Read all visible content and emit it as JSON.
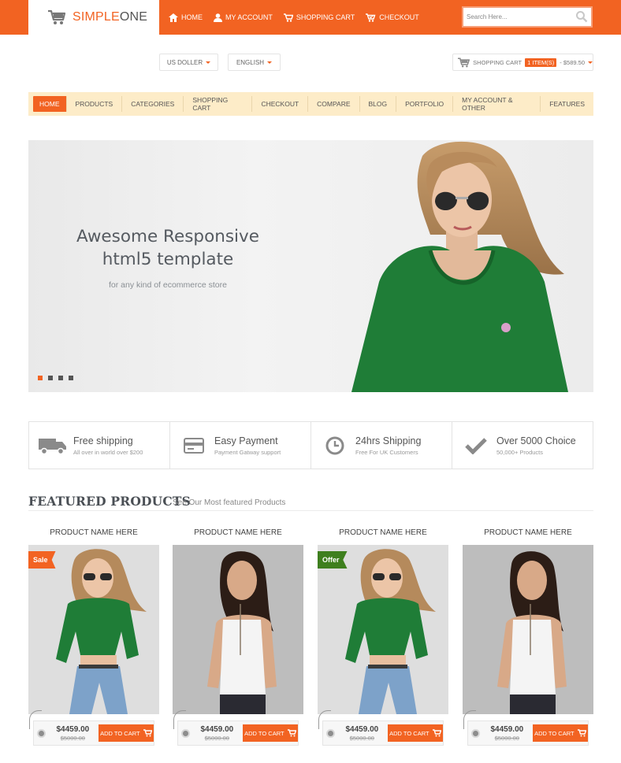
{
  "brand": {
    "name_part1": "SIMPLE",
    "name_part2": "ONE",
    "logo_icon": "cart-icon",
    "accent_color": "#f26322",
    "nav_bg_color": "#fdecc8"
  },
  "top_nav": [
    {
      "label": "HOME",
      "icon": "home-icon"
    },
    {
      "label": "MY ACCOUNT",
      "icon": "user-icon"
    },
    {
      "label": "SHOPPING CART",
      "icon": "cart-icon"
    },
    {
      "label": "CHECKOUT",
      "icon": "cart-check-icon"
    }
  ],
  "search": {
    "placeholder": "Search Here...",
    "icon": "search-icon"
  },
  "currency": {
    "selected": "US DOLLER"
  },
  "language": {
    "selected": "ENGLISH"
  },
  "cart_summary": {
    "label": "SHOPPING CART",
    "items": "1 ITEM(S)",
    "total": "- $589.50"
  },
  "main_nav": [
    {
      "label": "HOME",
      "active": true
    },
    {
      "label": "PRODUCTS"
    },
    {
      "label": "CATEGORIES"
    },
    {
      "label": "SHOPPING CART"
    },
    {
      "label": "CHECKOUT"
    },
    {
      "label": "COMPARE"
    },
    {
      "label": "BLOG"
    },
    {
      "label": "PORTFOLIO"
    },
    {
      "label": "MY ACCOUNT & OTHER"
    },
    {
      "label": "FEATURES"
    }
  ],
  "hero": {
    "title_line1": "Awesome Responsive",
    "title_line2": "html5 template",
    "subtitle": "for any kind of ecommerce store",
    "slide_count": 4,
    "active_slide": 1
  },
  "features": [
    {
      "title": "Free shipping",
      "subtitle": "All over in world over $200",
      "icon": "truck-icon"
    },
    {
      "title": "Easy Payment",
      "subtitle": "Payment Gatway support",
      "icon": "credit-card-icon"
    },
    {
      "title": "24hrs Shipping",
      "subtitle": "Free For UK Customers",
      "icon": "clock-icon"
    },
    {
      "title": "Over 5000 Choice",
      "subtitle": "50,000+ Products",
      "icon": "checkmark-icon"
    }
  ],
  "featured": {
    "title": "FEATURED PRODUCTS",
    "subtitle": "See Our Most featured Products"
  },
  "products": [
    {
      "name": "PRODUCT NAME HERE",
      "price": "$4459.00",
      "old_price": "$5000.00",
      "button": "ADD TO CART",
      "tag": "Sale"
    },
    {
      "name": "PRODUCT NAME HERE",
      "price": "$4459.00",
      "old_price": "$5000.00",
      "button": "ADD TO CART",
      "tag": ""
    },
    {
      "name": "PRODUCT NAME HERE",
      "price": "$4459.00",
      "old_price": "$5000.00",
      "button": "ADD TO CART",
      "tag": "Offer"
    },
    {
      "name": "PRODUCT NAME HERE",
      "price": "$4459.00",
      "old_price": "$5000.00",
      "button": "ADD TO CART",
      "tag": ""
    }
  ]
}
